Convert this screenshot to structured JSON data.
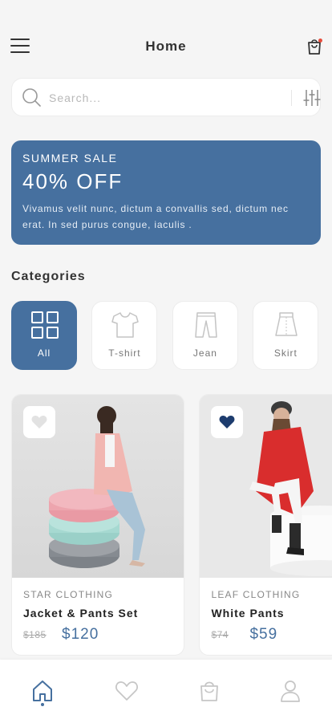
{
  "header": {
    "title": "Home",
    "menu_icon": "hamburger-menu-icon",
    "cart_icon": "shopping-bag-icon"
  },
  "search": {
    "placeholder": "Search...",
    "value": "",
    "filter_icon": "sliders-icon"
  },
  "banner": {
    "title": "SUMMER SALE",
    "discount": "40% OFF",
    "description": "Vivamus velit nunc, dictum a convallis sed, dictum nec erat. In sed purus congue, iaculis ."
  },
  "categories": {
    "title": "Categories",
    "items": [
      {
        "label": "All",
        "icon": "grid-icon",
        "active": true
      },
      {
        "label": "T-shirt",
        "icon": "tshirt-icon",
        "active": false
      },
      {
        "label": "Jean",
        "icon": "jeans-icon",
        "active": false
      },
      {
        "label": "Skirt",
        "icon": "skirt-icon",
        "active": false
      }
    ]
  },
  "products": [
    {
      "brand": "STAR CLOTHING",
      "name": "Jacket & Pants Set",
      "old_price": "$185",
      "price": "$120",
      "favorited": false
    },
    {
      "brand": "LEAF CLOTHING",
      "name": "White Pants",
      "old_price": "$74",
      "price": "$59",
      "favorited": true
    }
  ],
  "tabbar": {
    "items": [
      {
        "icon": "home-icon",
        "active": true
      },
      {
        "icon": "heart-icon",
        "active": false
      },
      {
        "icon": "shopping-bag-icon",
        "active": false
      },
      {
        "icon": "user-icon",
        "active": false
      }
    ]
  },
  "colors": {
    "accent": "#46709f",
    "background": "#f5f5f5",
    "badge": "#e74c3c"
  }
}
